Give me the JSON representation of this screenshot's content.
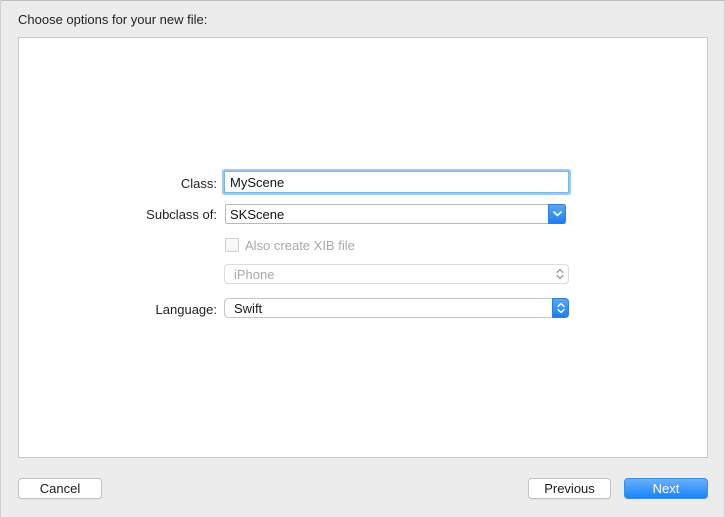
{
  "header": {
    "title": "Choose options for your new file:"
  },
  "form": {
    "class_label": "Class:",
    "class_value": "MyScene",
    "subclass_label": "Subclass of:",
    "subclass_value": "SKScene",
    "xib_label": "Also create XIB file",
    "xib_checked": false,
    "device_value": "iPhone",
    "language_label": "Language:",
    "language_value": "Swift"
  },
  "buttons": {
    "cancel": "Cancel",
    "previous": "Previous",
    "next": "Next"
  },
  "icons": {
    "subclass_dropdown": "chevron-down-icon",
    "device_popup": "up-down-chevron-icon",
    "language_popup": "up-down-chevron-icon"
  },
  "colors": {
    "accent": "#1a82fb",
    "focus_ring": "#9cc9f0"
  }
}
